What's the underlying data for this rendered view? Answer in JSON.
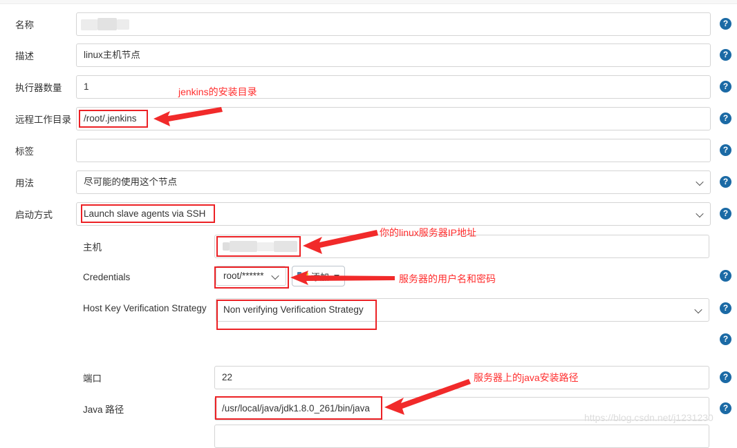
{
  "page": {
    "watermark": "https://blog.csdn.net/j1231230"
  },
  "form": {
    "fields": [
      {
        "label": "名称",
        "value": "",
        "type": "text",
        "redacted": true,
        "help": "?"
      },
      {
        "label": "描述",
        "value": "linux主机节点",
        "type": "text",
        "help": "?"
      },
      {
        "label": "执行器数量",
        "value": "1",
        "type": "text",
        "help": "?"
      },
      {
        "label": "远程工作目录",
        "value": "/root/.jenkins",
        "type": "text",
        "highlighted": true,
        "help": "?"
      },
      {
        "label": "标签",
        "value": "",
        "type": "text",
        "help": "?"
      },
      {
        "label": "用法",
        "value": "尽可能的使用这个节点",
        "type": "select",
        "help": "?"
      },
      {
        "label": "启动方式",
        "value": "Launch slave agents via SSH",
        "type": "select",
        "highlighted": true,
        "help": "?"
      }
    ],
    "ssh": {
      "host": {
        "label": "主机",
        "value": "",
        "redacted": true,
        "highlighted": true,
        "help": "?"
      },
      "credentials": {
        "label": "Credentials",
        "value": "root/******",
        "highlighted": true,
        "add_button_label": "添加",
        "help": "?"
      },
      "host_key_strategy": {
        "label": "Host Key Verification Strategy",
        "value": "Non verifying Verification Strategy",
        "highlighted": true,
        "help": "?"
      },
      "extra_help": "?",
      "port": {
        "label": "端口",
        "value": "22",
        "help": "?"
      },
      "java_path": {
        "label": "Java 路径",
        "value": "/usr/local/java/jdk1.8.0_261/bin/java",
        "highlighted": true,
        "help": "?"
      }
    }
  },
  "annotations": [
    {
      "text": "jenkins的安装目录"
    },
    {
      "text": "你的linux服务器IP地址"
    },
    {
      "text": "服务器的用户名和密码"
    },
    {
      "text": "服务器上的java安装路径"
    }
  ]
}
